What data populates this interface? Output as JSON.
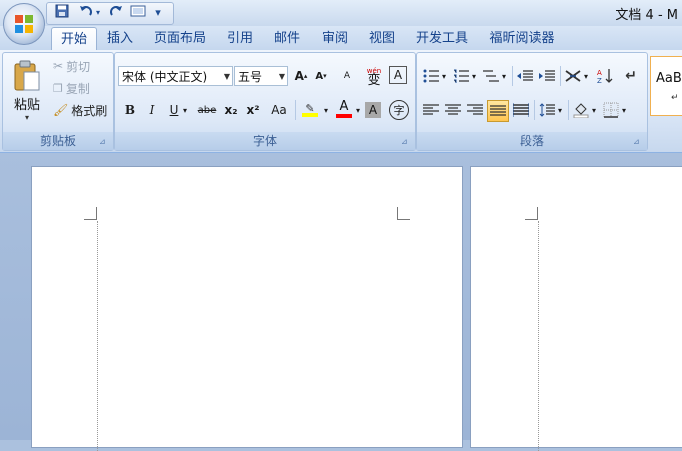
{
  "window": {
    "title": "文档 4 - M"
  },
  "quick_access": {
    "save_icon": "save-icon",
    "undo_icon": "undo-icon",
    "redo_icon": "redo-icon",
    "print_preview_icon": "print-preview-icon",
    "customize": "▾"
  },
  "tabs": [
    "开始",
    "插入",
    "页面布局",
    "引用",
    "邮件",
    "审阅",
    "视图",
    "开发工具",
    "福昕阅读器"
  ],
  "active_tab": "开始",
  "clipboard": {
    "label": "剪贴板",
    "paste": "粘贴",
    "cut": "剪切",
    "copy": "复制",
    "format_painter": "格式刷"
  },
  "font": {
    "label": "字体",
    "font_name": "宋体 (中文正文)",
    "font_size": "五号",
    "grow": "A",
    "shrink": "A",
    "clear_format": "A",
    "phonetic": "wén",
    "phonetic_char": "变",
    "char_border": "A",
    "bold": "B",
    "italic": "I",
    "underline": "U",
    "strike": "abe",
    "subscript": "x₂",
    "superscript": "x²",
    "change_case": "Aa",
    "highlight": "ab",
    "font_color": "A",
    "char_shading": "A",
    "enclose": "字"
  },
  "paragraph": {
    "label": "段落"
  },
  "styles": {
    "sample_text": "AaBl",
    "sample_mark": "↵"
  },
  "colors": {
    "highlight": "#ffff00",
    "font_color": "#ff0000",
    "accent": "#15428b"
  }
}
